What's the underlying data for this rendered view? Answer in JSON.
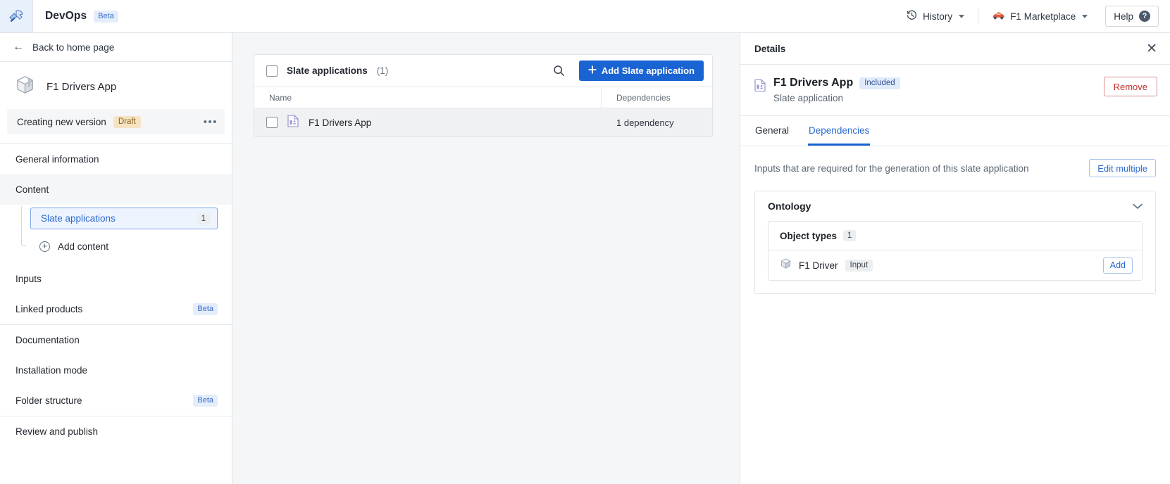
{
  "topbar": {
    "logo_icon": "devops-hammer-logo-icon",
    "brand_name": "DevOps",
    "brand_badge": "Beta",
    "history_label": "History",
    "history_icon": "history-clock-icon",
    "marketplace_label": "F1 Marketplace",
    "marketplace_icon": "race-car-icon",
    "help_label": "Help",
    "help_icon": "question-mark-icon"
  },
  "sidebar": {
    "back_label": "Back to home page",
    "back_icon": "arrow-left-icon",
    "app_icon": "package-box-icon",
    "app_name": "F1 Drivers App",
    "version_label": "Creating new version",
    "version_badge": "Draft",
    "more_icon": "more-options-icon",
    "nav": [
      {
        "label": "General information"
      },
      {
        "label": "Content"
      },
      {
        "label": "Inputs"
      },
      {
        "label": "Linked products",
        "badge": "Beta"
      },
      {
        "label": "Documentation"
      },
      {
        "label": "Installation mode"
      },
      {
        "label": "Folder structure",
        "badge": "Beta"
      },
      {
        "label": "Review and publish"
      }
    ],
    "sub_item_label": "Slate applications",
    "sub_item_count": "1",
    "add_content_label": "Add content",
    "add_content_icon": "plus-circle-icon"
  },
  "main": {
    "card_title": "Slate applications",
    "card_count": "(1)",
    "search_icon": "search-icon",
    "add_button_label": "Add Slate application",
    "add_button_icon": "plus-icon",
    "columns": [
      "Name",
      "Dependencies"
    ],
    "rows": [
      {
        "name": "F1 Drivers App",
        "icon": "slate-document-icon",
        "dependencies": "1 dependency"
      }
    ]
  },
  "details": {
    "title": "Details",
    "close_icon": "close-icon",
    "entity_icon": "slate-document-icon",
    "entity_name": "F1 Drivers App",
    "entity_badge": "Included",
    "entity_subtitle": "Slate application",
    "remove_label": "Remove",
    "tabs": [
      {
        "label": "General",
        "active": false
      },
      {
        "label": "Dependencies",
        "active": true
      }
    ],
    "dependencies": {
      "description": "Inputs that are required for the generation of this slate application",
      "edit_multiple_label": "Edit multiple",
      "group_title": "Ontology",
      "collapse_icon": "chevron-down-icon",
      "section_title": "Object types",
      "section_count": "1",
      "items": [
        {
          "icon": "object-type-cube-icon",
          "name": "F1 Driver",
          "badge": "Input",
          "action_label": "Add"
        }
      ]
    }
  },
  "colors": {
    "accent_blue": "#1964d2",
    "link_blue": "#2a6ad0",
    "danger_red": "#c23030",
    "draft_amber": "#8a6116",
    "panel_bg": "#f5f6f8"
  }
}
